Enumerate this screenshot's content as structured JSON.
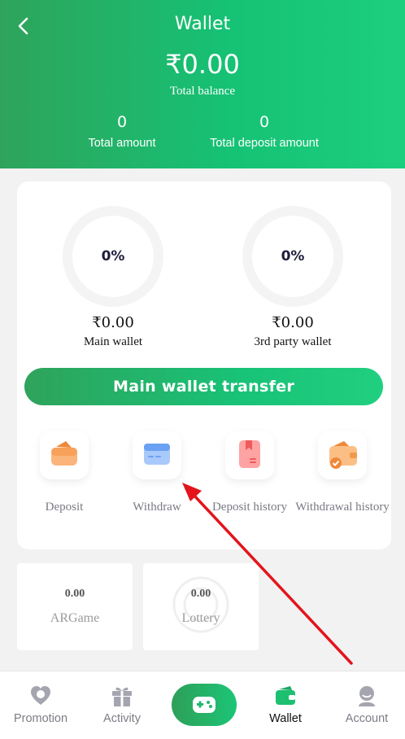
{
  "header": {
    "title": "Wallet",
    "total_balance": "₹0.00",
    "total_balance_label": "Total balance",
    "stats": [
      {
        "value": "0",
        "label": "Total amount"
      },
      {
        "value": "0",
        "label": "Total deposit amount"
      }
    ]
  },
  "wallets": [
    {
      "percent": "0%",
      "amount": "₹0.00",
      "label": "Main wallet"
    },
    {
      "percent": "0%",
      "amount": "₹0.00",
      "label": "3rd party wallet"
    }
  ],
  "transfer_button": "Main wallet transfer",
  "actions": [
    {
      "label": "Deposit",
      "icon": "deposit-icon"
    },
    {
      "label": "Withdraw",
      "icon": "withdraw-card-icon"
    },
    {
      "label": "Deposit history",
      "icon": "deposit-history-icon"
    },
    {
      "label": "Withdrawal history",
      "icon": "withdrawal-history-icon"
    }
  ],
  "games": [
    {
      "value": "0.00",
      "name": "ARGame"
    },
    {
      "value": "0.00",
      "name": "Lottery"
    }
  ],
  "bottom_nav": [
    {
      "label": "Promotion",
      "icon": "promotion-icon",
      "active": false
    },
    {
      "label": "Activity",
      "icon": "gift-icon",
      "active": false
    },
    {
      "label": "",
      "icon": "gamepad-icon",
      "active": false
    },
    {
      "label": "Wallet",
      "icon": "wallet-icon",
      "active": true
    },
    {
      "label": "Account",
      "icon": "account-icon",
      "active": false
    }
  ],
  "colors": {
    "brand_green": "#16c174",
    "annotation_red": "#e3141c"
  }
}
